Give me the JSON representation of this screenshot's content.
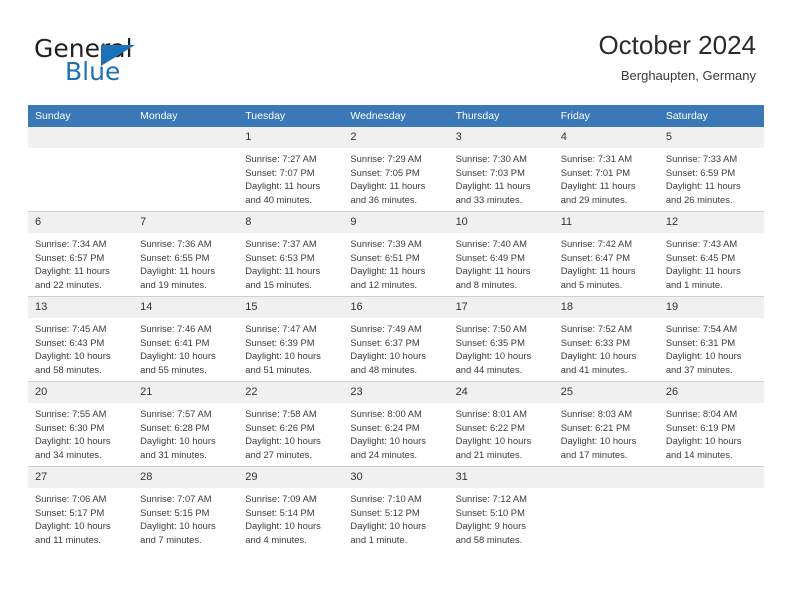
{
  "brand": {
    "name_top": "General",
    "name_bottom": "Blue",
    "triangle_color": "#1d71b8"
  },
  "header": {
    "title": "October 2024",
    "subtitle": "Berghaupten, Germany"
  },
  "theme": {
    "header_row_bg": "#3b78b8",
    "daynum_bg": "#f0f0f0",
    "grid_line": "#cfcfcf",
    "text": "#3c3c3c"
  },
  "weekdays": [
    "Sunday",
    "Monday",
    "Tuesday",
    "Wednesday",
    "Thursday",
    "Friday",
    "Saturday"
  ],
  "labels": {
    "sunrise": "Sunrise:",
    "sunset": "Sunset:",
    "daylight": "Daylight:"
  },
  "weeks": [
    [
      {
        "day": "",
        "empty": true
      },
      {
        "day": "",
        "empty": true
      },
      {
        "day": "1",
        "sunrise": "Sunrise: 7:27 AM",
        "sunset": "Sunset: 7:07 PM",
        "daylight1": "Daylight: 11 hours",
        "daylight2": "and 40 minutes."
      },
      {
        "day": "2",
        "sunrise": "Sunrise: 7:29 AM",
        "sunset": "Sunset: 7:05 PM",
        "daylight1": "Daylight: 11 hours",
        "daylight2": "and 36 minutes."
      },
      {
        "day": "3",
        "sunrise": "Sunrise: 7:30 AM",
        "sunset": "Sunset: 7:03 PM",
        "daylight1": "Daylight: 11 hours",
        "daylight2": "and 33 minutes."
      },
      {
        "day": "4",
        "sunrise": "Sunrise: 7:31 AM",
        "sunset": "Sunset: 7:01 PM",
        "daylight1": "Daylight: 11 hours",
        "daylight2": "and 29 minutes."
      },
      {
        "day": "5",
        "sunrise": "Sunrise: 7:33 AM",
        "sunset": "Sunset: 6:59 PM",
        "daylight1": "Daylight: 11 hours",
        "daylight2": "and 26 minutes."
      }
    ],
    [
      {
        "day": "6",
        "sunrise": "Sunrise: 7:34 AM",
        "sunset": "Sunset: 6:57 PM",
        "daylight1": "Daylight: 11 hours",
        "daylight2": "and 22 minutes."
      },
      {
        "day": "7",
        "sunrise": "Sunrise: 7:36 AM",
        "sunset": "Sunset: 6:55 PM",
        "daylight1": "Daylight: 11 hours",
        "daylight2": "and 19 minutes."
      },
      {
        "day": "8",
        "sunrise": "Sunrise: 7:37 AM",
        "sunset": "Sunset: 6:53 PM",
        "daylight1": "Daylight: 11 hours",
        "daylight2": "and 15 minutes."
      },
      {
        "day": "9",
        "sunrise": "Sunrise: 7:39 AM",
        "sunset": "Sunset: 6:51 PM",
        "daylight1": "Daylight: 11 hours",
        "daylight2": "and 12 minutes."
      },
      {
        "day": "10",
        "sunrise": "Sunrise: 7:40 AM",
        "sunset": "Sunset: 6:49 PM",
        "daylight1": "Daylight: 11 hours",
        "daylight2": "and 8 minutes."
      },
      {
        "day": "11",
        "sunrise": "Sunrise: 7:42 AM",
        "sunset": "Sunset: 6:47 PM",
        "daylight1": "Daylight: 11 hours",
        "daylight2": "and 5 minutes."
      },
      {
        "day": "12",
        "sunrise": "Sunrise: 7:43 AM",
        "sunset": "Sunset: 6:45 PM",
        "daylight1": "Daylight: 11 hours",
        "daylight2": "and 1 minute."
      }
    ],
    [
      {
        "day": "13",
        "sunrise": "Sunrise: 7:45 AM",
        "sunset": "Sunset: 6:43 PM",
        "daylight1": "Daylight: 10 hours",
        "daylight2": "and 58 minutes."
      },
      {
        "day": "14",
        "sunrise": "Sunrise: 7:46 AM",
        "sunset": "Sunset: 6:41 PM",
        "daylight1": "Daylight: 10 hours",
        "daylight2": "and 55 minutes."
      },
      {
        "day": "15",
        "sunrise": "Sunrise: 7:47 AM",
        "sunset": "Sunset: 6:39 PM",
        "daylight1": "Daylight: 10 hours",
        "daylight2": "and 51 minutes."
      },
      {
        "day": "16",
        "sunrise": "Sunrise: 7:49 AM",
        "sunset": "Sunset: 6:37 PM",
        "daylight1": "Daylight: 10 hours",
        "daylight2": "and 48 minutes."
      },
      {
        "day": "17",
        "sunrise": "Sunrise: 7:50 AM",
        "sunset": "Sunset: 6:35 PM",
        "daylight1": "Daylight: 10 hours",
        "daylight2": "and 44 minutes."
      },
      {
        "day": "18",
        "sunrise": "Sunrise: 7:52 AM",
        "sunset": "Sunset: 6:33 PM",
        "daylight1": "Daylight: 10 hours",
        "daylight2": "and 41 minutes."
      },
      {
        "day": "19",
        "sunrise": "Sunrise: 7:54 AM",
        "sunset": "Sunset: 6:31 PM",
        "daylight1": "Daylight: 10 hours",
        "daylight2": "and 37 minutes."
      }
    ],
    [
      {
        "day": "20",
        "sunrise": "Sunrise: 7:55 AM",
        "sunset": "Sunset: 6:30 PM",
        "daylight1": "Daylight: 10 hours",
        "daylight2": "and 34 minutes."
      },
      {
        "day": "21",
        "sunrise": "Sunrise: 7:57 AM",
        "sunset": "Sunset: 6:28 PM",
        "daylight1": "Daylight: 10 hours",
        "daylight2": "and 31 minutes."
      },
      {
        "day": "22",
        "sunrise": "Sunrise: 7:58 AM",
        "sunset": "Sunset: 6:26 PM",
        "daylight1": "Daylight: 10 hours",
        "daylight2": "and 27 minutes."
      },
      {
        "day": "23",
        "sunrise": "Sunrise: 8:00 AM",
        "sunset": "Sunset: 6:24 PM",
        "daylight1": "Daylight: 10 hours",
        "daylight2": "and 24 minutes."
      },
      {
        "day": "24",
        "sunrise": "Sunrise: 8:01 AM",
        "sunset": "Sunset: 6:22 PM",
        "daylight1": "Daylight: 10 hours",
        "daylight2": "and 21 minutes."
      },
      {
        "day": "25",
        "sunrise": "Sunrise: 8:03 AM",
        "sunset": "Sunset: 6:21 PM",
        "daylight1": "Daylight: 10 hours",
        "daylight2": "and 17 minutes."
      },
      {
        "day": "26",
        "sunrise": "Sunrise: 8:04 AM",
        "sunset": "Sunset: 6:19 PM",
        "daylight1": "Daylight: 10 hours",
        "daylight2": "and 14 minutes."
      }
    ],
    [
      {
        "day": "27",
        "sunrise": "Sunrise: 7:06 AM",
        "sunset": "Sunset: 5:17 PM",
        "daylight1": "Daylight: 10 hours",
        "daylight2": "and 11 minutes."
      },
      {
        "day": "28",
        "sunrise": "Sunrise: 7:07 AM",
        "sunset": "Sunset: 5:15 PM",
        "daylight1": "Daylight: 10 hours",
        "daylight2": "and 7 minutes."
      },
      {
        "day": "29",
        "sunrise": "Sunrise: 7:09 AM",
        "sunset": "Sunset: 5:14 PM",
        "daylight1": "Daylight: 10 hours",
        "daylight2": "and 4 minutes."
      },
      {
        "day": "30",
        "sunrise": "Sunrise: 7:10 AM",
        "sunset": "Sunset: 5:12 PM",
        "daylight1": "Daylight: 10 hours",
        "daylight2": "and 1 minute."
      },
      {
        "day": "31",
        "sunrise": "Sunrise: 7:12 AM",
        "sunset": "Sunset: 5:10 PM",
        "daylight1": "Daylight: 9 hours",
        "daylight2": "and 58 minutes."
      },
      {
        "day": "",
        "empty": true
      },
      {
        "day": "",
        "empty": true
      }
    ]
  ]
}
